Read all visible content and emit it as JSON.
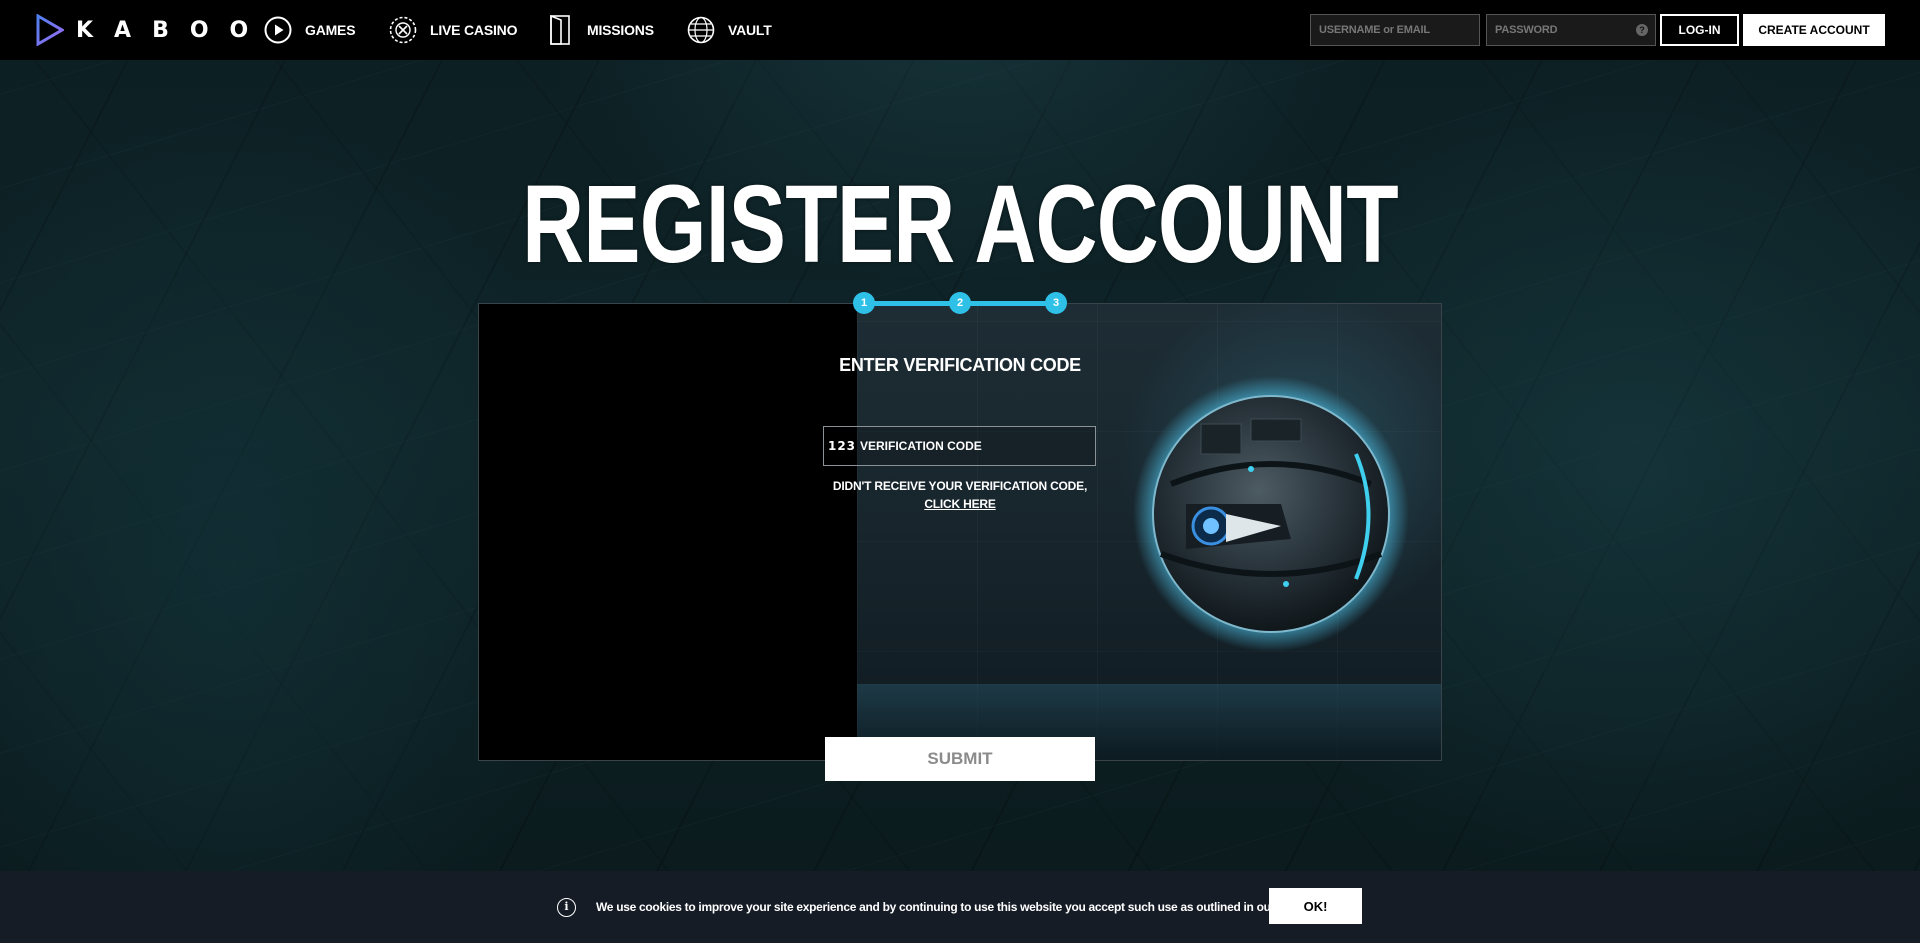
{
  "header": {
    "logo_text": "KABOO",
    "nav": [
      {
        "label": "GAMES",
        "icon": "play-circle-icon"
      },
      {
        "label": "LIVE CASINO",
        "icon": "roulette-icon"
      },
      {
        "label": "MISSIONS",
        "icon": "door-icon"
      },
      {
        "label": "VAULT",
        "icon": "globe-icon"
      }
    ],
    "username_placeholder": "USERNAME or EMAIL",
    "password_placeholder": "PASSWORD",
    "help_glyph": "?",
    "login_label": "LOG-IN",
    "create_label": "CREATE ACCOUNT"
  },
  "page": {
    "title": "REGISTER ACCOUNT"
  },
  "stepper": {
    "steps": [
      "1",
      "2",
      "3"
    ],
    "color": "#2ec0e6"
  },
  "form": {
    "heading": "ENTER VERIFICATION CODE",
    "code_icon": "123",
    "code_placeholder": "VERIFICATION CODE",
    "resend_text": "DIDN'T RECEIVE YOUR VERIFICATION CODE,",
    "resend_link": "CLICK HERE",
    "submit_label": "SUBMIT"
  },
  "cookie": {
    "icon": "i",
    "text": "We use cookies to improve your site experience and by continuing to use this website you accept such use as outlined in our",
    "ok_label": "OK!"
  }
}
